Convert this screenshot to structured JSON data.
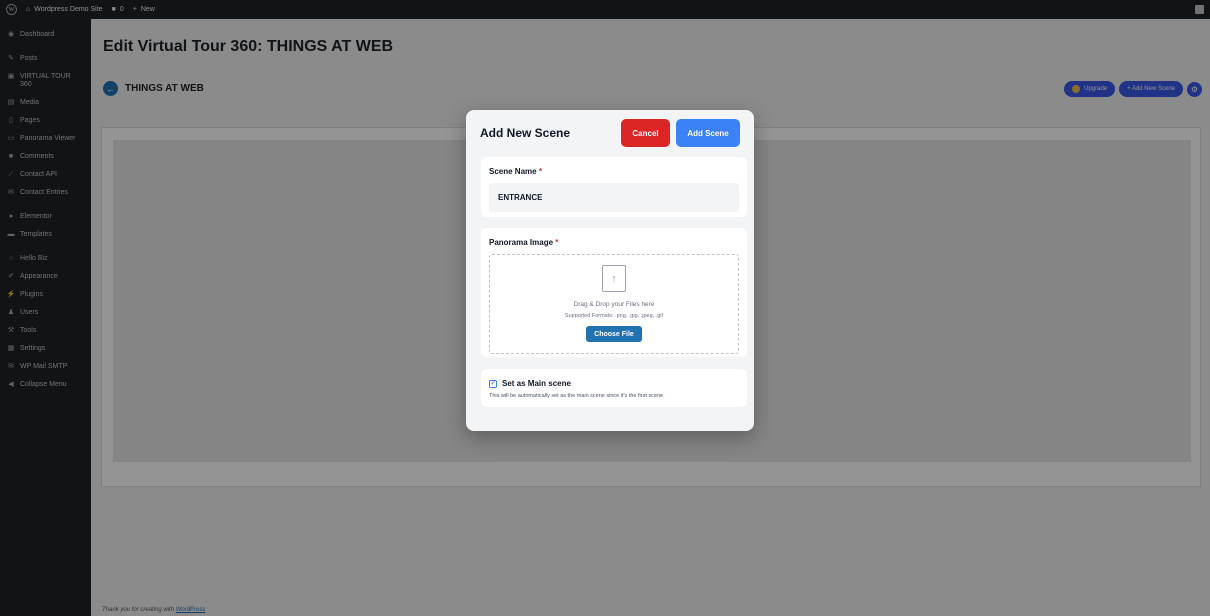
{
  "adminbar": {
    "site_name": "Wordpress Demo Site",
    "comments_count": "0",
    "new_label": "New"
  },
  "sidebar": {
    "items": [
      {
        "label": "Dashboard",
        "icon": "dashboard-icon"
      },
      {
        "label": "Posts",
        "icon": "pin-icon"
      },
      {
        "label": "VIRTUAL TOUR 360",
        "icon": "tour-icon"
      },
      {
        "label": "Media",
        "icon": "media-icon"
      },
      {
        "label": "Pages",
        "icon": "page-icon"
      },
      {
        "label": "Panorama Viewer",
        "icon": "panorama-icon"
      },
      {
        "label": "Comments",
        "icon": "comment-icon"
      },
      {
        "label": "Contact API",
        "icon": "api-icon"
      },
      {
        "label": "Contact Entries",
        "icon": "mail-icon"
      },
      {
        "label": "Elementor",
        "icon": "elementor-icon"
      },
      {
        "label": "Templates",
        "icon": "folder-icon"
      },
      {
        "label": "Hello Biz",
        "icon": "hello-icon"
      },
      {
        "label": "Appearance",
        "icon": "brush-icon"
      },
      {
        "label": "Plugins",
        "icon": "plug-icon"
      },
      {
        "label": "Users",
        "icon": "user-icon"
      },
      {
        "label": "Tools",
        "icon": "wrench-icon"
      },
      {
        "label": "Settings",
        "icon": "settings-icon"
      },
      {
        "label": "WP Mail SMTP",
        "icon": "smtp-icon"
      },
      {
        "label": "Collapse Menu",
        "icon": "collapse-icon"
      }
    ]
  },
  "main": {
    "page_title": "Edit Virtual Tour 360: THINGS AT WEB",
    "tour_name": "THINGS AT WEB",
    "upgrade_label": "Upgrade",
    "add_scene_label": "+ Add New Scene",
    "footer_prefix": "Thank you for creating with",
    "footer_link": "WordPress"
  },
  "modal": {
    "title": "Add New Scene",
    "cancel_label": "Cancel",
    "add_label": "Add Scene",
    "scene_name_label": "Scene Name",
    "scene_name_value": "ENTRANCE",
    "panorama_label": "Panorama Image",
    "required_mark": "*",
    "drop_text": "Drag & Drop your Files here",
    "formats_text": "Supported Formats: .png, .jpg, .jpeg, .gif",
    "choose_label": "Choose File",
    "main_scene_label": "Set as Main scene",
    "main_scene_checked": true,
    "main_scene_note": "This will be automatically set as the main scene since it's the first scene."
  },
  "colors": {
    "admin_dark": "#1d2327",
    "wp_blue": "#2271b1",
    "cancel_red": "#dc2626",
    "add_blue": "#3b82f6"
  }
}
